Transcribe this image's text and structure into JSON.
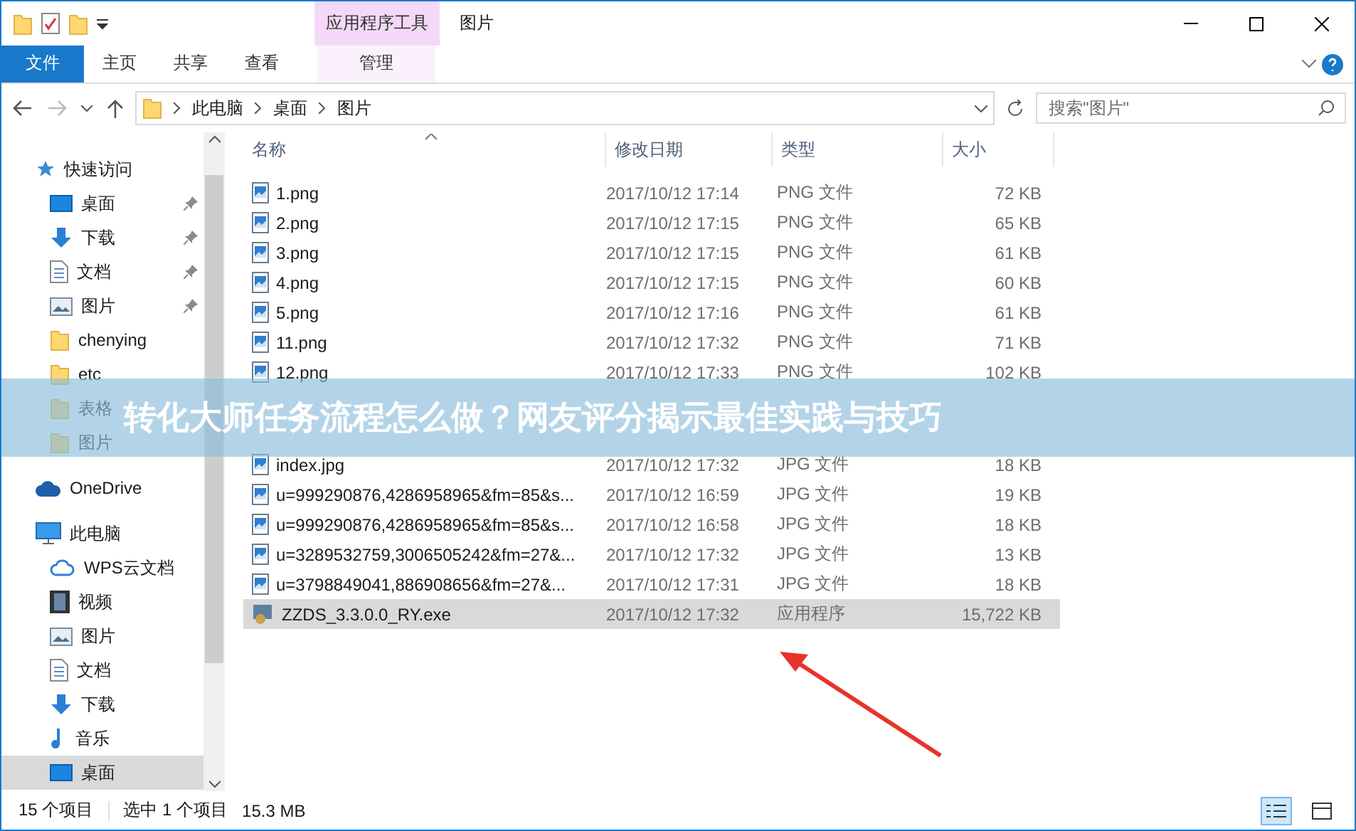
{
  "window": {
    "title": "图片",
    "context_tab": "应用程序工具"
  },
  "ribbon": {
    "tabs": [
      {
        "label": "文件",
        "kind": "file"
      },
      {
        "label": "主页",
        "kind": "plain"
      },
      {
        "label": "共享",
        "kind": "plain"
      },
      {
        "label": "查看",
        "kind": "plain"
      },
      {
        "label": "管理",
        "kind": "context"
      }
    ]
  },
  "address": {
    "path": [
      "此电脑",
      "桌面",
      "图片"
    ],
    "search_placeholder": "搜索\"图片\""
  },
  "nav": {
    "sections": [
      {
        "label": "快速访问",
        "kind": "star",
        "children": [
          {
            "label": "桌面",
            "kind": "desktop",
            "pinned": true,
            "selected": false
          },
          {
            "label": "下载",
            "kind": "download",
            "pinned": true,
            "selected": false
          },
          {
            "label": "文档",
            "kind": "document",
            "pinned": true,
            "selected": false
          },
          {
            "label": "图片",
            "kind": "picture",
            "pinned": true,
            "selected": false
          },
          {
            "label": "chenying",
            "kind": "folder",
            "pinned": false,
            "selected": false
          },
          {
            "label": "etc",
            "kind": "folder",
            "pinned": false,
            "selected": false
          },
          {
            "label": "表格",
            "kind": "folder",
            "pinned": false,
            "selected": false
          },
          {
            "label": "图片",
            "kind": "folder",
            "pinned": false,
            "selected": false
          }
        ]
      },
      {
        "label": "OneDrive",
        "kind": "onedrive"
      },
      {
        "label": "此电脑",
        "kind": "pc",
        "children": [
          {
            "label": "WPS云文档",
            "kind": "wps",
            "pinned": false,
            "selected": false
          },
          {
            "label": "视频",
            "kind": "video",
            "pinned": false,
            "selected": false
          },
          {
            "label": "图片",
            "kind": "picture",
            "pinned": false,
            "selected": false
          },
          {
            "label": "文档",
            "kind": "document",
            "pinned": false,
            "selected": false
          },
          {
            "label": "下载",
            "kind": "download",
            "pinned": false,
            "selected": false
          },
          {
            "label": "音乐",
            "kind": "music",
            "pinned": false,
            "selected": false
          },
          {
            "label": "桌面",
            "kind": "desktop",
            "pinned": false,
            "selected": true
          }
        ]
      }
    ]
  },
  "file_list": {
    "columns": [
      "名称",
      "修改日期",
      "类型",
      "大小"
    ],
    "rows": [
      {
        "name": "1.png",
        "modified": "2017/10/12 17:14",
        "type": "PNG 文件",
        "size": "72 KB",
        "kind": "image",
        "selected": false
      },
      {
        "name": "2.png",
        "modified": "2017/10/12 17:15",
        "type": "PNG 文件",
        "size": "65 KB",
        "kind": "image",
        "selected": false
      },
      {
        "name": "3.png",
        "modified": "2017/10/12 17:15",
        "type": "PNG 文件",
        "size": "61 KB",
        "kind": "image",
        "selected": false
      },
      {
        "name": "4.png",
        "modified": "2017/10/12 17:15",
        "type": "PNG 文件",
        "size": "60 KB",
        "kind": "image",
        "selected": false
      },
      {
        "name": "5.png",
        "modified": "2017/10/12 17:16",
        "type": "PNG 文件",
        "size": "61 KB",
        "kind": "image",
        "selected": false
      },
      {
        "name": "11.png",
        "modified": "2017/10/12 17:32",
        "type": "PNG 文件",
        "size": "71 KB",
        "kind": "image",
        "selected": false
      },
      {
        "name": "12.png",
        "modified": "2017/10/12 17:33",
        "type": "PNG 文件",
        "size": "102 KB",
        "kind": "image",
        "selected": false
      },
      {
        "name": "index.jpg",
        "modified": "2017/10/12 17:32",
        "type": "JPG 文件",
        "size": "18 KB",
        "kind": "image",
        "selected": false
      },
      {
        "name": "u=999290876,4286958965&fm=85&s...",
        "modified": "2017/10/12 16:59",
        "type": "JPG 文件",
        "size": "19 KB",
        "kind": "image",
        "selected": false
      },
      {
        "name": "u=999290876,4286958965&fm=85&s...",
        "modified": "2017/10/12 16:58",
        "type": "JPG 文件",
        "size": "18 KB",
        "kind": "image",
        "selected": false
      },
      {
        "name": "u=3289532759,3006505242&fm=27&...",
        "modified": "2017/10/12 17:32",
        "type": "JPG 文件",
        "size": "13 KB",
        "kind": "image",
        "selected": false
      },
      {
        "name": "u=3798849041,886908656&fm=27&...",
        "modified": "2017/10/12 17:31",
        "type": "JPG 文件",
        "size": "18 KB",
        "kind": "image",
        "selected": false
      },
      {
        "name": "ZZDS_3.3.0.0_RY.exe",
        "modified": "2017/10/12 17:32",
        "type": "应用程序",
        "size": "15,722 KB",
        "kind": "exe",
        "selected": true
      }
    ]
  },
  "status_bar": {
    "count": "15 个项目",
    "selection": "选中 1 个项目",
    "size": "15.3 MB"
  },
  "overlay_banner": {
    "text": "转化大师任务流程怎么做？网友评分揭示最佳实践与技巧"
  }
}
